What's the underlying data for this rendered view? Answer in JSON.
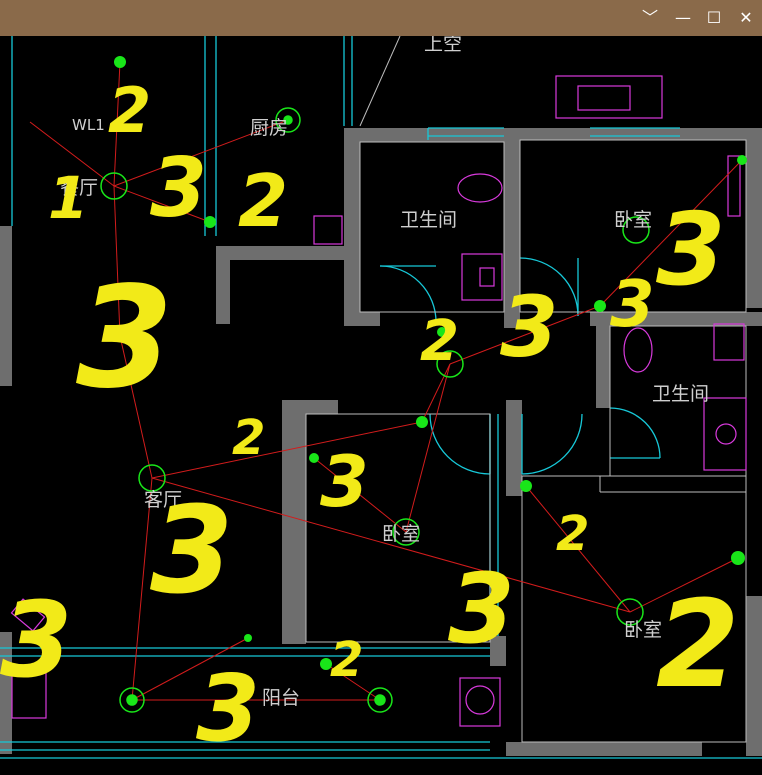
{
  "window": {
    "controls": {
      "dropdown": "﹀",
      "minimize": "—",
      "maximize": "☐",
      "close": "✕"
    }
  },
  "plan": {
    "rooms": {
      "top_right_partial": "上空",
      "dining": "餐厅",
      "kitchen": "厨房",
      "bath_1": "卫生间",
      "bedroom_ne": "卧室",
      "bath_2": "卫生间",
      "living": "客厅",
      "bedroom_center": "卧室",
      "bedroom_se": "卧室",
      "balcony": "阳台"
    },
    "circuit_label": "WL1"
  },
  "annotations": [
    "1",
    "2",
    "3",
    "2",
    "3",
    "3",
    "3",
    "3",
    "2",
    "3",
    "2",
    "3",
    "3",
    "2",
    "2",
    "3",
    "2"
  ],
  "colors": {
    "wall": "#6e6e6e",
    "cyan_line": "#17c8d8",
    "fixture_magenta": "#d83adc",
    "wire_red": "#d21c1c",
    "node_green": "#19e619",
    "marker_yellow": "#f2ea18",
    "label_gray": "#cfcfcf",
    "titlebar": "#8a6a4a"
  }
}
